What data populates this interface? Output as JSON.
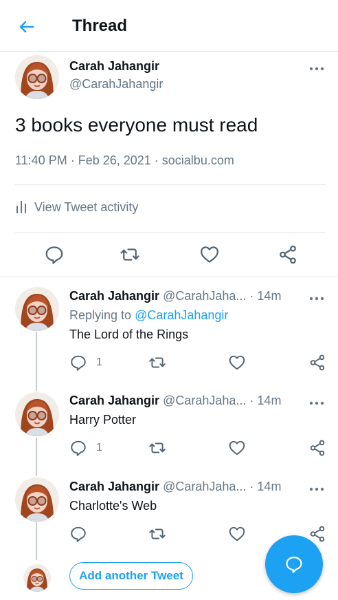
{
  "colors": {
    "accent": "#1da1f2",
    "muted": "#657786",
    "text": "#0f1419",
    "divider": "#e1e5e8"
  },
  "header": {
    "title": "Thread",
    "back_icon": "arrow-left-icon"
  },
  "main_tweet": {
    "author_name": "Carah Jahangir",
    "author_handle": "@CarahJahangir",
    "text": "3 books everyone must read",
    "meta": "11:40 PM · Feb 26, 2021 · socialbu.com",
    "activity_label": "View Tweet activity",
    "actions": [
      "reply-icon",
      "retweet-icon",
      "like-icon",
      "share-icon"
    ]
  },
  "replies": [
    {
      "author_name": "Carah Jahangir",
      "author_handle": "@CarahJaha...",
      "time": "· 14m",
      "replying_prefix": "Replying to",
      "replying_handle": "@CarahJahangir",
      "text": "The Lord of the Rings",
      "reply_count": "1"
    },
    {
      "author_name": "Carah Jahangir",
      "author_handle": "@CarahJaha...",
      "time": "· 14m",
      "text": "Harry Potter",
      "reply_count": "1"
    },
    {
      "author_name": "Carah Jahangir",
      "author_handle": "@CarahJaha...",
      "time": "· 14m",
      "text": "Charlotte's Web",
      "reply_count": ""
    }
  ],
  "composer": {
    "add_label": "Add another Tweet"
  },
  "fab": {
    "icon": "compose-reply-icon"
  }
}
